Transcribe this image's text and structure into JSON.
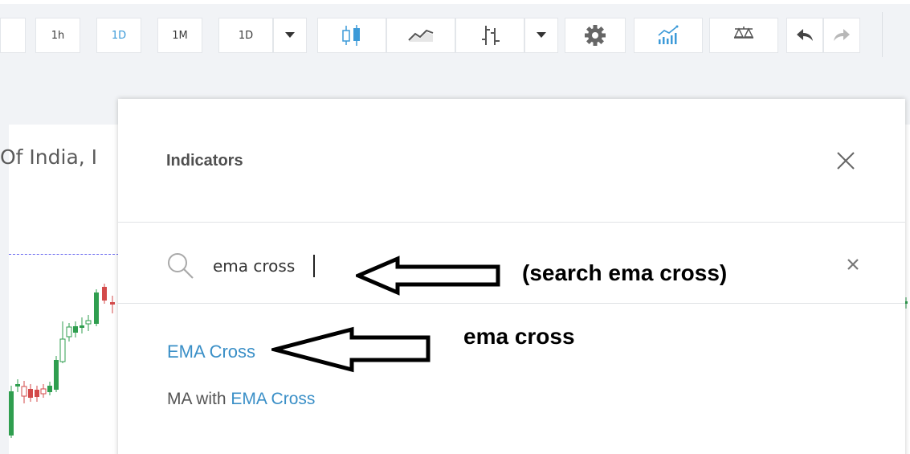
{
  "toolbar": {
    "intervals": [
      "1h",
      "1D",
      "1M",
      "1D"
    ],
    "active_interval_index": 1,
    "accent_color": "#3c9ad8",
    "icons": [
      "chevron-down-icon",
      "candles-icon",
      "area-line-icon",
      "bars-icon",
      "chevron-down-icon",
      "gear-icon",
      "indicators-icon",
      "compare-icon",
      "undo-icon",
      "redo-icon"
    ]
  },
  "chart": {
    "symbol_title": "Of India, I"
  },
  "indicators_dialog": {
    "title": "Indicators",
    "search": {
      "value": "ema cross",
      "placeholder": ""
    },
    "results": [
      {
        "label": "EMA Cross"
      },
      {
        "prefix": "MA with ",
        "match": "EMA Cross"
      }
    ]
  },
  "annotations": {
    "search_note": "(search ema cross)",
    "result_note": "ema cross"
  }
}
